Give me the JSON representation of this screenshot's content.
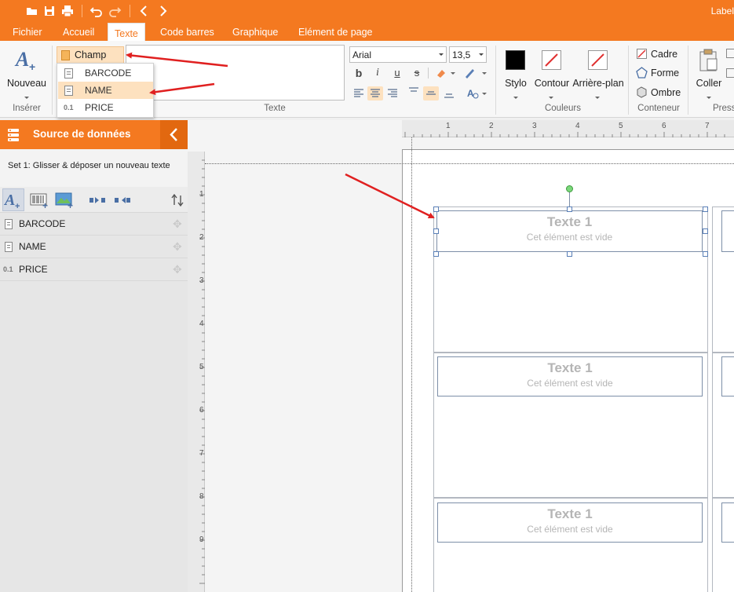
{
  "app": {
    "title": "Label"
  },
  "menu": {
    "tabs": [
      "Fichier",
      "Accueil",
      "Texte",
      "Code barres",
      "Graphique",
      "Elément de page"
    ],
    "active_tab": "Texte"
  },
  "ribbon": {
    "insert": {
      "new_label": "Nouveau",
      "group_label": "Insérer"
    },
    "field_button": "Champ",
    "field_menu": [
      {
        "label": "BARCODE",
        "icon": "text-field-icon"
      },
      {
        "label": "NAME",
        "icon": "text-field-icon",
        "highlighted": true
      },
      {
        "label": "PRICE",
        "icon": "number-field-icon",
        "prefix": "0.1"
      }
    ],
    "text_group_label": "Texte",
    "font": {
      "family": "Arial",
      "size": "13,5"
    },
    "colors": {
      "stylo": "Stylo",
      "contour": "Contour",
      "arriere_plan": "Arrière-plan",
      "group_label": "Couleurs",
      "stylo_color": "#000000",
      "slash_color": "#e03030"
    },
    "container": {
      "cadre": "Cadre",
      "forme": "Forme",
      "ombre": "Ombre",
      "group_label": "Conteneur"
    },
    "paste": {
      "label": "Coller",
      "group_label": "Presse"
    }
  },
  "sidebar": {
    "title": "Source de données",
    "subtitle": "Set 1: Glisser & déposer un nouveau texte",
    "fields": [
      {
        "label": "BARCODE",
        "type": "text"
      },
      {
        "label": "NAME",
        "type": "text"
      },
      {
        "label": "PRICE",
        "type": "number",
        "prefix": "0.1"
      }
    ]
  },
  "ruler": {
    "top": [
      "1",
      "2",
      "3",
      "4",
      "5",
      "6",
      "7"
    ],
    "left": [
      "1",
      "2",
      "3",
      "4",
      "5",
      "6",
      "7",
      "8",
      "9",
      "10"
    ]
  },
  "labels": [
    {
      "title": "Texte 1",
      "placeholder": "Cet élément est vide"
    },
    {
      "title": "Texte 1",
      "placeholder": "Cet élément est vide"
    },
    {
      "title": "Texte 1",
      "placeholder": "Cet élément est vide"
    }
  ],
  "accent_color": "#f47920",
  "annotation_color": "#e02020"
}
